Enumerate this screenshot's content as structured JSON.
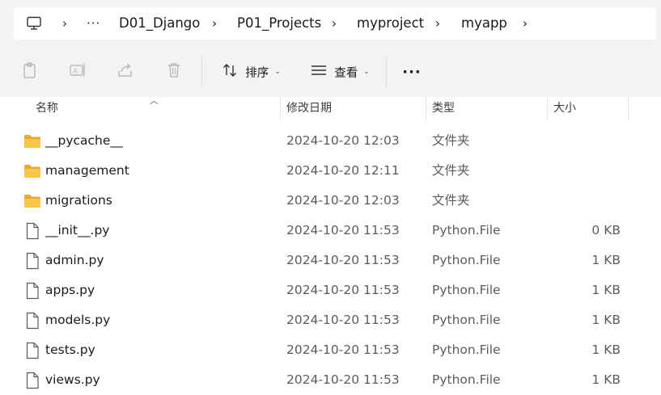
{
  "breadcrumb": {
    "items": [
      "D01_Django",
      "P01_Projects",
      "myproject",
      "myapp"
    ]
  },
  "toolbar": {
    "sort_label": "排序",
    "view_label": "查看"
  },
  "columns": {
    "name": "名称",
    "date": "修改日期",
    "type": "类型",
    "size": "大小"
  },
  "files": [
    {
      "name": "__pycache__",
      "date": "2024-10-20 12:03",
      "type": "文件夹",
      "size": "",
      "icon": "folder-icon"
    },
    {
      "name": "management",
      "date": "2024-10-20 12:11",
      "type": "文件夹",
      "size": "",
      "icon": "folder-icon"
    },
    {
      "name": "migrations",
      "date": "2024-10-20 12:03",
      "type": "文件夹",
      "size": "",
      "icon": "folder-icon"
    },
    {
      "name": "__init__.py",
      "date": "2024-10-20 11:53",
      "type": "Python.File",
      "size": "0 KB",
      "icon": "file-icon"
    },
    {
      "name": "admin.py",
      "date": "2024-10-20 11:53",
      "type": "Python.File",
      "size": "1 KB",
      "icon": "file-icon"
    },
    {
      "name": "apps.py",
      "date": "2024-10-20 11:53",
      "type": "Python.File",
      "size": "1 KB",
      "icon": "file-icon"
    },
    {
      "name": "models.py",
      "date": "2024-10-20 11:53",
      "type": "Python.File",
      "size": "1 KB",
      "icon": "file-icon"
    },
    {
      "name": "tests.py",
      "date": "2024-10-20 11:53",
      "type": "Python.File",
      "size": "1 KB",
      "icon": "file-icon"
    },
    {
      "name": "views.py",
      "date": "2024-10-20 11:53",
      "type": "Python.File",
      "size": "1 KB",
      "icon": "file-icon"
    }
  ],
  "colors": {
    "folder": "#f8c64a",
    "chrome_bg": "#f3f3f3"
  }
}
